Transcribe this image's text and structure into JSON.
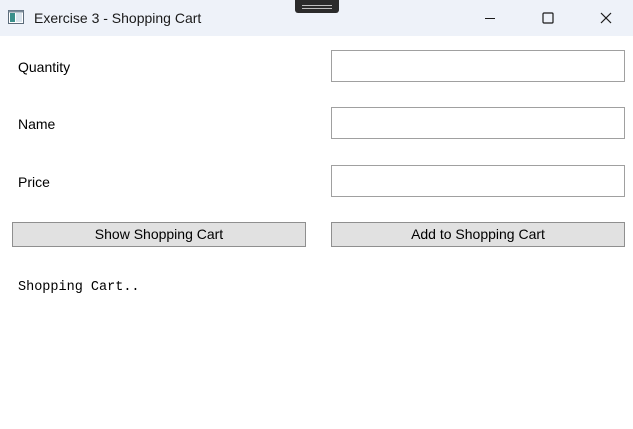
{
  "window": {
    "title": "Exercise 3 - Shopping Cart",
    "icon": "app-window-icon",
    "controls": {
      "minimize_icon": "minimize-icon",
      "maximize_icon": "maximize-icon",
      "close_icon": "close-icon"
    }
  },
  "form": {
    "quantity": {
      "label": "Quantity",
      "value": "",
      "placeholder": ""
    },
    "name": {
      "label": "Name",
      "value": "",
      "placeholder": ""
    },
    "price": {
      "label": "Price",
      "value": "",
      "placeholder": ""
    }
  },
  "buttons": {
    "show_cart_label": "Show Shopping Cart",
    "add_to_cart_label": "Add to Shopping Cart"
  },
  "output": {
    "text": "Shopping Cart.."
  },
  "colors": {
    "titlebar": "#eef2f9",
    "button_face": "#e1e1e1",
    "button_border": "#8f8f8f",
    "textbox_border": "#a0a0a0"
  }
}
